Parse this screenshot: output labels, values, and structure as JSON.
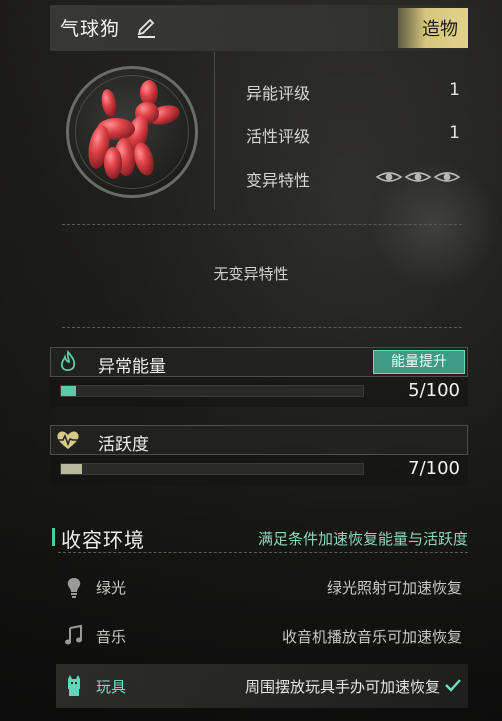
{
  "header": {
    "title": "气球狗",
    "type_badge": "造物"
  },
  "stats": [
    {
      "label": "异能评级",
      "value": "1"
    },
    {
      "label": "活性评级",
      "value": "1"
    },
    {
      "label": "变异特性",
      "value": ""
    }
  ],
  "trait_text": "无变异特性",
  "energy": {
    "label": "异常能量",
    "upgrade_label": "能量提升",
    "current": 5,
    "max": 100,
    "value_text": "5/100",
    "fill_fraction": 0.05,
    "color": "#5ec9a8"
  },
  "activity": {
    "label": "活跃度",
    "current": 7,
    "max": 100,
    "value_text": "7/100",
    "fill_fraction": 0.07,
    "color": "#b8b89c"
  },
  "environment": {
    "title": "收容环境",
    "subtitle": "满足条件加速恢复能量与活跃度",
    "items": [
      {
        "name": "绿光",
        "desc": "绿光照射可加速恢复",
        "icon": "bulb-icon",
        "active": false
      },
      {
        "name": "音乐",
        "desc": "收音机播放音乐可加速恢复",
        "icon": "music-note-icon",
        "active": false
      },
      {
        "name": "玩具",
        "desc": "周围摆放玩具手办可加速恢复",
        "icon": "toy-icon",
        "active": true
      }
    ]
  },
  "colors": {
    "accent": "#4fc9a5",
    "badge": "#d7c77e",
    "balloon": "#e0454a"
  }
}
